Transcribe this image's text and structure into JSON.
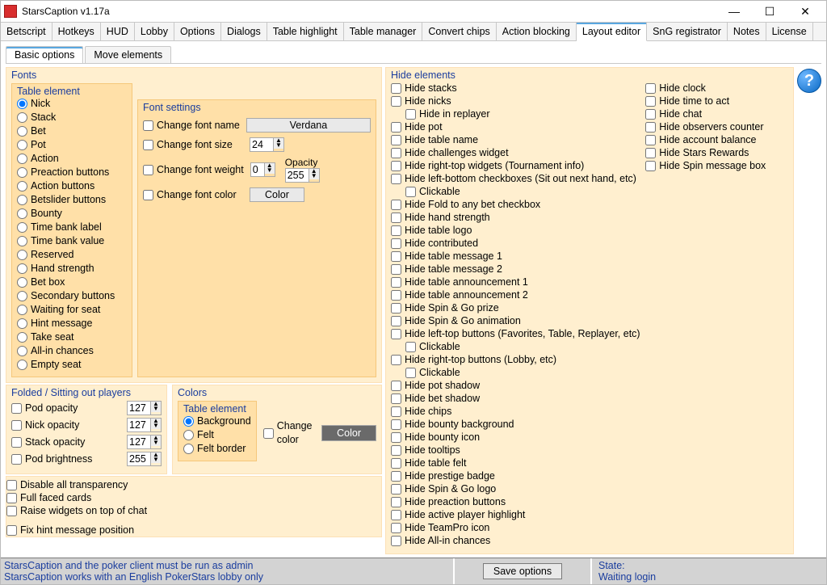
{
  "window": {
    "title": "StarsCaption v1.17a"
  },
  "main_tabs": [
    "Betscript",
    "Hotkeys",
    "HUD",
    "Lobby",
    "Options",
    "Dialogs",
    "Table highlight",
    "Table manager",
    "Convert chips",
    "Action blocking",
    "Layout editor",
    "SnG registrator",
    "Notes",
    "License"
  ],
  "main_tab_active": "Layout editor",
  "sub_tabs": [
    "Basic options",
    "Move elements"
  ],
  "sub_tab_active": "Basic options",
  "fonts": {
    "legend": "Fonts",
    "table_element_legend": "Table element",
    "elements": [
      "Nick",
      "Stack",
      "Bet",
      "Pot",
      "Action",
      "Preaction buttons",
      "Action buttons",
      "Betslider buttons",
      "Bounty",
      "Time bank label",
      "Time bank value",
      "Reserved",
      "Hand strength",
      "Bet box",
      "Secondary buttons",
      "Waiting for seat",
      "Hint message",
      "Take seat",
      "All-in chances",
      "Empty seat"
    ],
    "element_selected": "Nick",
    "font_settings_legend": "Font settings",
    "change_font_name": "Change font name",
    "font_name_btn": "Verdana",
    "change_font_size": "Change font size",
    "font_size": "24",
    "change_font_weight": "Change font weight",
    "font_weight": "0",
    "change_font_color": "Change font color",
    "color_btn": "Color",
    "opacity_label": "Opacity",
    "opacity": "255"
  },
  "folded": {
    "legend": "Folded / Sitting out players",
    "pod_opacity": "Pod opacity",
    "pod_opacity_v": "127",
    "nick_opacity": "Nick opacity",
    "nick_opacity_v": "127",
    "stack_opacity": "Stack opacity",
    "stack_opacity_v": "127",
    "pod_brightness": "Pod brightness",
    "pod_brightness_v": "255"
  },
  "colors": {
    "legend": "Colors",
    "table_element_legend": "Table element",
    "options": [
      "Background",
      "Felt",
      "Felt border"
    ],
    "selected": "Background",
    "change_color": "Change color",
    "color_btn": "Color"
  },
  "bottom_checks": {
    "disable_transparency": "Disable all transparency",
    "full_faced": "Full faced cards",
    "raise_widgets": "Raise widgets on top of chat",
    "fix_hint": "Fix hint message position"
  },
  "hide": {
    "legend": "Hide elements",
    "col1": [
      {
        "t": "Hide stacks"
      },
      {
        "t": "Hide nicks"
      },
      {
        "t": "Hide in replayer",
        "indent": true
      },
      {
        "t": "Hide pot"
      },
      {
        "t": "Hide table name"
      },
      {
        "t": "Hide challenges widget"
      },
      {
        "t": "Hide right-top widgets (Tournament info)"
      },
      {
        "t": "Hide left-bottom checkboxes (Sit out next hand, etc)"
      },
      {
        "t": "Clickable",
        "indent": true
      },
      {
        "t": "Hide Fold to any bet checkbox"
      },
      {
        "t": "Hide hand strength"
      },
      {
        "t": "Hide table logo"
      },
      {
        "t": "Hide contributed"
      },
      {
        "t": "Hide table message 1"
      },
      {
        "t": "Hide table message 2"
      },
      {
        "t": "Hide table announcement 1"
      },
      {
        "t": "Hide table announcement 2"
      },
      {
        "t": "Hide Spin & Go prize"
      },
      {
        "t": "Hide Spin & Go animation"
      },
      {
        "t": "Hide left-top buttons (Favorites, Table, Replayer, etc)"
      },
      {
        "t": "Clickable",
        "indent": true
      },
      {
        "t": "Hide right-top buttons (Lobby, etc)"
      },
      {
        "t": "Clickable",
        "indent": true
      },
      {
        "t": "Hide pot shadow"
      },
      {
        "t": "Hide bet shadow"
      },
      {
        "t": "Hide chips"
      },
      {
        "t": "Hide bounty background"
      },
      {
        "t": "Hide bounty icon"
      },
      {
        "t": "Hide tooltips"
      },
      {
        "t": "Hide table felt"
      },
      {
        "t": "Hide prestige badge"
      },
      {
        "t": "Hide Spin & Go logo"
      },
      {
        "t": "Hide preaction buttons"
      },
      {
        "t": "Hide active player highlight"
      },
      {
        "t": "Hide TeamPro icon"
      },
      {
        "t": "Hide All-in chances"
      }
    ],
    "col2": [
      {
        "t": "Hide clock"
      },
      {
        "t": "Hide time to act"
      },
      {
        "t": "Hide chat"
      },
      {
        "t": "Hide observers counter"
      },
      {
        "t": "Hide account balance"
      },
      {
        "t": "Hide Stars Rewards"
      },
      {
        "t": "Hide Spin message box"
      }
    ]
  },
  "status": {
    "line1": "StarsCaption and the poker client must be run as admin",
    "line2": "StarsCaption works with an English PokerStars lobby only",
    "save": "Save options",
    "state_label": "State:",
    "state_value": "Waiting login"
  }
}
